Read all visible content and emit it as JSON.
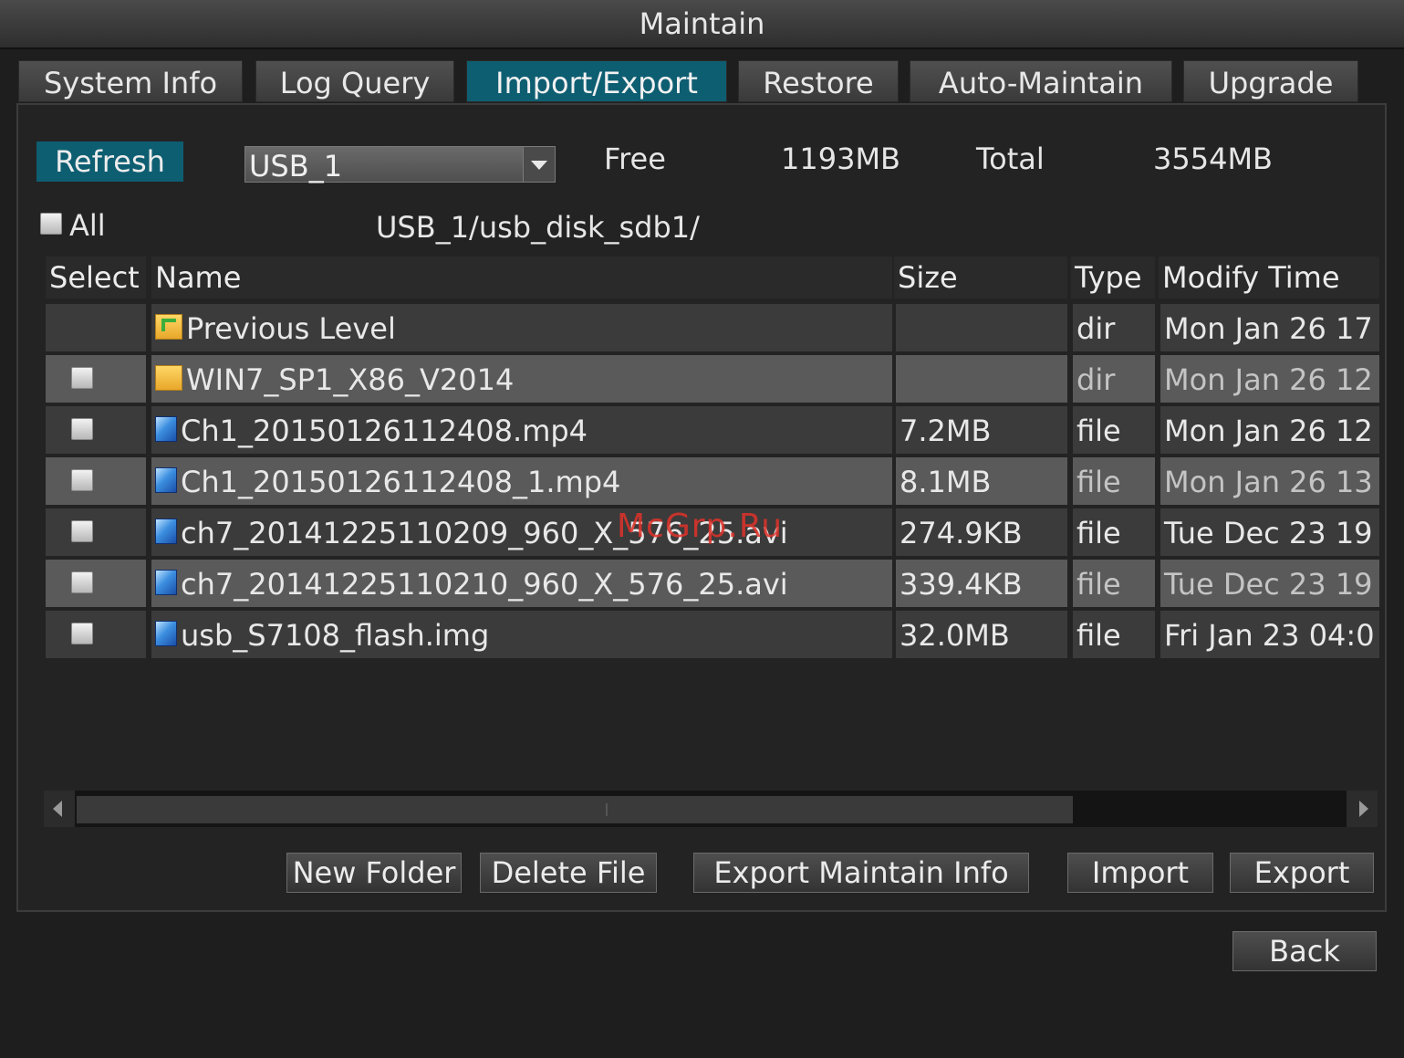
{
  "window": {
    "title": "Maintain"
  },
  "tabs": [
    {
      "label": "System Info",
      "active": false
    },
    {
      "label": "Log Query",
      "active": false
    },
    {
      "label": "Import/Export",
      "active": true
    },
    {
      "label": "Restore",
      "active": false
    },
    {
      "label": "Auto-Maintain",
      "active": false
    },
    {
      "label": "Upgrade",
      "active": false
    }
  ],
  "toolbar": {
    "refresh_label": "Refresh",
    "device_selected": "USB_1",
    "free_label": "Free",
    "free_value": "1193MB",
    "total_label": "Total",
    "total_value": "3554MB"
  },
  "path_bar": {
    "all_label": "All",
    "path": "USB_1/usb_disk_sdb1/"
  },
  "table": {
    "columns": [
      "Select",
      "Name",
      "Size",
      "Type",
      "Modify Time"
    ],
    "rows": [
      {
        "name": "Previous Level",
        "size": "",
        "type": "dir",
        "modified": "Mon Jan 26 17",
        "icon": "folder-up-icon",
        "checkbox": false
      },
      {
        "name": "WIN7_SP1_X86_V2014",
        "size": "",
        "type": "dir",
        "modified": "Mon Jan 26 12",
        "icon": "folder-icon",
        "checkbox": true
      },
      {
        "name": "Ch1_20150126112408.mp4",
        "size": "7.2MB",
        "type": "file",
        "modified": "Mon Jan 26 12",
        "icon": "file-icon",
        "checkbox": true
      },
      {
        "name": "Ch1_20150126112408_1.mp4",
        "size": "8.1MB",
        "type": "file",
        "modified": "Mon Jan 26 13",
        "icon": "file-icon",
        "checkbox": true
      },
      {
        "name": "ch7_20141225110209_960_X_576_25.avi",
        "size": "274.9KB",
        "type": "file",
        "modified": "Tue Dec 23 19",
        "icon": "file-icon",
        "checkbox": true
      },
      {
        "name": "ch7_20141225110210_960_X_576_25.avi",
        "size": "339.4KB",
        "type": "file",
        "modified": "Tue Dec 23 19",
        "icon": "file-icon",
        "checkbox": true
      },
      {
        "name": "usb_S7108_flash.img",
        "size": "32.0MB",
        "type": "file",
        "modified": "Fri Jan 23 04:0",
        "icon": "file-icon",
        "checkbox": true
      }
    ]
  },
  "actions": {
    "new_folder": "New Folder",
    "delete_file": "Delete File",
    "export_maintain_info": "Export Maintain Info",
    "import": "Import",
    "export": "Export"
  },
  "footer": {
    "back": "Back"
  },
  "watermark": "McGrp.Ru",
  "colors": {
    "accent": "#0e5e72",
    "background": "#1e1e1e",
    "row_odd": "#3b3b3b",
    "row_even": "#5a5a5a"
  }
}
